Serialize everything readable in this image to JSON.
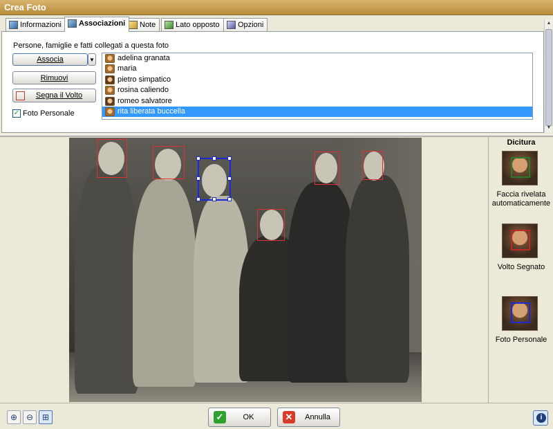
{
  "window": {
    "title": "Crea Foto"
  },
  "tabs": [
    {
      "label": "Informazioni",
      "icon": "info-card-icon",
      "active": false
    },
    {
      "label": "Associazioni",
      "icon": "people-link-icon",
      "active": true
    },
    {
      "label": "Note",
      "icon": "notes-icon",
      "active": false
    },
    {
      "label": "Lato opposto",
      "icon": "photo-back-icon",
      "active": false
    },
    {
      "label": "Opzioni",
      "icon": "options-icon",
      "active": false
    }
  ],
  "associations": {
    "heading": "Persone, famiglie e fatti collegati a questa foto",
    "associa_label": "Associa",
    "rimuovi_label": "Rimuovi",
    "segna_label": "Segna il Volto",
    "personal_photo_label": "Foto Personale",
    "personal_photo_checked": true,
    "people": [
      {
        "name": "adelina granata",
        "gender": "female",
        "selected": false
      },
      {
        "name": "maria",
        "gender": "female",
        "selected": false
      },
      {
        "name": "pietro simpatico",
        "gender": "male",
        "selected": false
      },
      {
        "name": "rosina caliendo",
        "gender": "female",
        "selected": false
      },
      {
        "name": "romeo salvatore",
        "gender": "male",
        "selected": false
      },
      {
        "name": "rita liberata buccella",
        "gender": "female",
        "selected": true
      }
    ]
  },
  "legend": {
    "title": "Dicitura",
    "items": [
      {
        "caption": "Faccia rivelata automaticamente",
        "box_color": "#2a7a2a"
      },
      {
        "caption": "Volto Segnato",
        "box_color": "#c02828"
      },
      {
        "caption": "Foto Personale",
        "box_color": "#1c2ad6"
      }
    ]
  },
  "footer": {
    "ok_label": "OK",
    "cancel_label": "Annulla"
  },
  "colors": {
    "face_marked": "#e23030",
    "face_personal": "#1c2ad6",
    "selection": "#3399ff"
  }
}
